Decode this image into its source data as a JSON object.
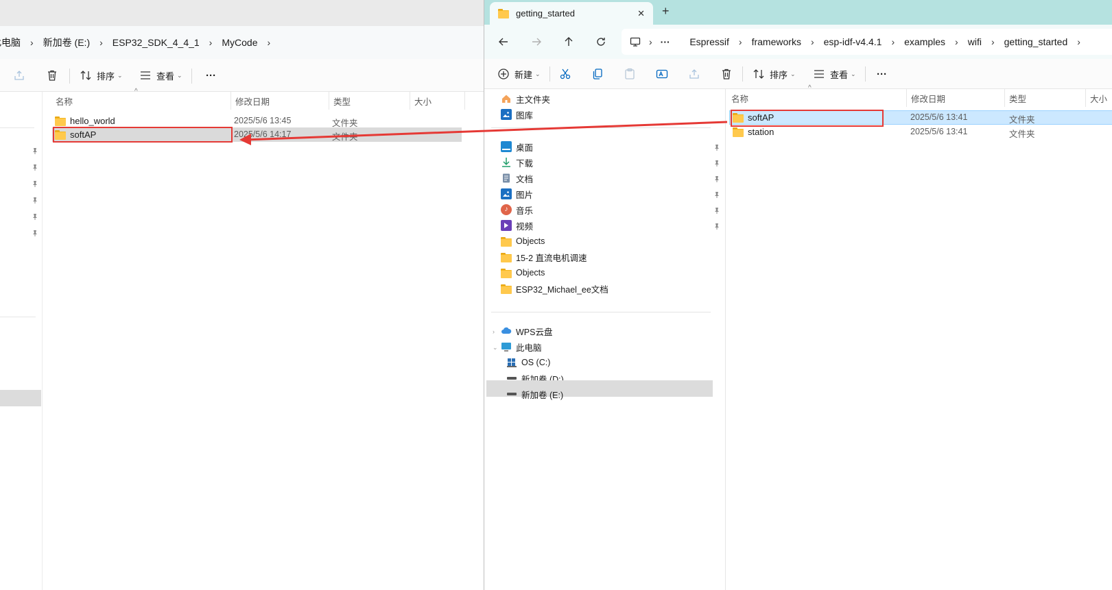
{
  "left": {
    "breadcrumbs": [
      "此电脑",
      "新加卷 (E:)",
      "ESP32_SDK_4_4_1",
      "MyCode"
    ],
    "toolbar": {
      "sort": "排序",
      "view": "查看",
      "more": "···"
    },
    "columns": {
      "name": "名称",
      "modified": "修改日期",
      "type": "类型",
      "size": "大小"
    },
    "rows": [
      {
        "name": "hello_world",
        "modified": "2025/5/6 13:45",
        "type": "文件夹"
      },
      {
        "name": "softAP",
        "modified": "2025/5/6 14:17",
        "type": "文件夹"
      }
    ]
  },
  "right": {
    "tab_title": "getting_started",
    "close_glyph": "✕",
    "new_tab_glyph": "+",
    "breadcrumbs": [
      "···",
      "Espressif",
      "frameworks",
      "esp-idf-v4.4.1",
      "examples",
      "wifi",
      "getting_started"
    ],
    "toolbar": {
      "new": "新建",
      "sort": "排序",
      "view": "查看",
      "more": "···"
    },
    "nav": {
      "top": [
        "主文件夹",
        "图库"
      ],
      "quick": [
        "桌面",
        "下载",
        "文档",
        "图片",
        "音乐",
        "视频",
        "Objects",
        "15-2 直流电机调速",
        "Objects",
        "ESP32_Michael_ee文档"
      ],
      "cloud": "WPS云盘",
      "pc": "此电脑",
      "drives": [
        "OS (C:)",
        "新加卷 (D:)",
        "新加卷 (E:)"
      ]
    },
    "columns": {
      "name": "名称",
      "modified": "修改日期",
      "type": "类型",
      "size": "大小"
    },
    "rows": [
      {
        "name": "softAP",
        "modified": "2025/5/6 13:41",
        "type": "文件夹"
      },
      {
        "name": "station",
        "modified": "2025/5/6 13:41",
        "type": "文件夹"
      }
    ]
  },
  "colors": {
    "highlight": "#e53935",
    "selection": "#cce8ff",
    "accent": "#0067c0"
  }
}
